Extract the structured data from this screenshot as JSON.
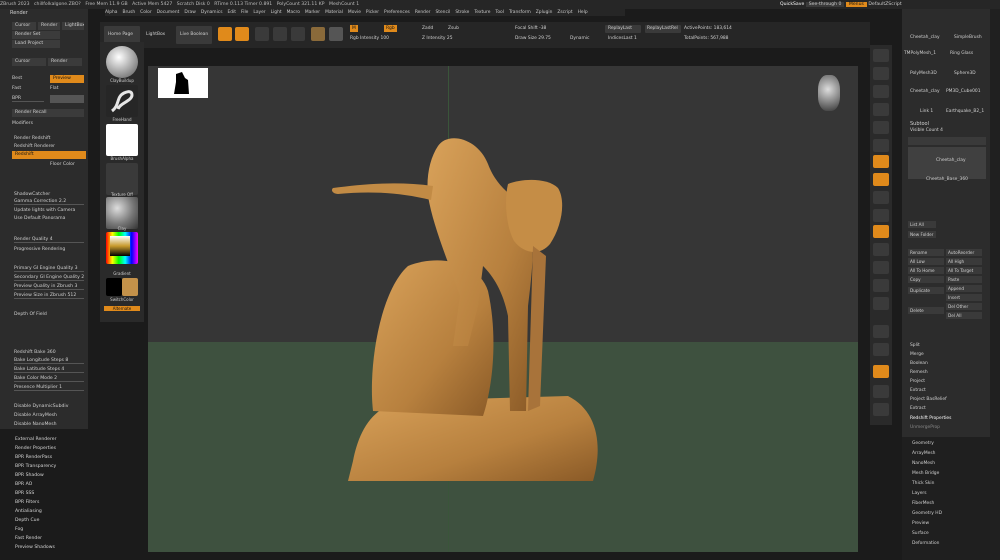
{
  "menubar": {
    "items": [
      "ZBrush 2023",
      "chillfolkalgone.ZBO?",
      "Free Mem 11.9 GB",
      "Active Mem 5427",
      "Scratch Disk 0",
      "RTime 0.113 Timer 0.891",
      "PolyCount 321.11 KP",
      "MeshCount 1"
    ],
    "menus": [
      "Alpha",
      "Brush",
      "Color",
      "Document",
      "Draw",
      "Dynamics",
      "Edit",
      "File",
      "Layer",
      "Light",
      "Macro",
      "Marker",
      "Material",
      "Movie",
      "Picker",
      "Preferences",
      "Render",
      "Stencil",
      "Stroke",
      "Texture",
      "Tool",
      "Transform",
      "Zplugin",
      "Zscript",
      "Help"
    ],
    "quicksave": "QuickSave",
    "seethrough": "See-through 0",
    "menus_btn": "Menus",
    "script": "DefaultZScript"
  },
  "left": {
    "title": "Render",
    "top_buttons": [
      "Cursor",
      "Render",
      "Best",
      "Preview",
      "Fast",
      "Flat"
    ],
    "lightbox": "LightBox",
    "render_set": "Render Set",
    "load_project": "Load Project",
    "bpr_btn": "BPR",
    "render_recall": "Render Recall",
    "modifiers": "Modifiers",
    "renderers": [
      "Render Redshift",
      "Redshift Renderer",
      "Redshift"
    ],
    "floor_color": "Floor Color",
    "shadowcatcher": "ShadowCatcher",
    "sliders": [
      {
        "label": "Gamma Correction 2.2",
        "v": 0.85
      },
      {
        "label": "Render Quality 4",
        "v": 0.35
      },
      {
        "label": "Primary GI Engine Quality 3",
        "v": 0.7
      },
      {
        "label": "Secondary GI Engine Quality 2",
        "v": 0.9
      },
      {
        "label": "Preview Quality in Zbrush 3",
        "v": 0.3
      },
      {
        "label": "Preview Size in Zbrush 512",
        "v": 0.55
      },
      {
        "label": "Bake Longitude Steps 8",
        "v": 0.3
      },
      {
        "label": "Bake Latitude Steps 4",
        "v": 0.3
      },
      {
        "label": "Bake Color Mode 2",
        "v": 0.4
      },
      {
        "label": "Presence Multiplier 1",
        "v": 0.2
      }
    ],
    "options": [
      "Update lights with Camera",
      "Use Default Panorama",
      "Progressive Rendering",
      "Depth Of Field",
      "Redshift Bake 360",
      "Disable DynamicSubdiv",
      "Disable ArrayMesh",
      "Disable NanoMesh"
    ],
    "bottom_list": [
      "External Renderer",
      "Render Properties",
      "BPR RenderPass",
      "BPR Transparency",
      "BPR Shadow",
      "BPR AO",
      "BPR SSS",
      "BPR Filters",
      "Antialiasing",
      "Depth Cue",
      "Fog",
      "Fast Render",
      "Preview Shadows"
    ]
  },
  "tools": {
    "labels": [
      "ClayBuildup",
      "FreeHand",
      "BrushAlpha",
      "Texture Off",
      "Clay",
      "Gradient",
      "SwitchColor",
      "Alternate"
    ]
  },
  "shelf": {
    "home": "Home Page",
    "lightbox": "LightBox",
    "live_boolean": "Live Boolean",
    "edit": "Edit",
    "draw": "Draw",
    "move": "Move",
    "scale": "Scale",
    "rotate": "Rotate",
    "m": "M",
    "rgb": "Rgb",
    "zadd": "Zadd",
    "zsub": "Zsub",
    "rgb_intensity": "Rgb Intensity 100",
    "z_intensity": "Z Intensity 25",
    "focal_shift": "Focal Shift -38",
    "draw_size": "Draw Size 29.75",
    "dynamic": "Dynamic",
    "replay_last": "ReplayLast",
    "replay_last_rel": "ReplayLastRel",
    "active_points": "ActivePoints: 183,614",
    "total_points": "TotalPoints: 567,988",
    "indices_last": "IndicesLast 1"
  },
  "right": {
    "top_tools": [
      "Cheetah_clay",
      "SimpleBrush",
      "TMPolyMesh_1",
      "Ring Glass",
      "PolyMesh3D",
      "Sphere3D",
      "Cheetah_clay",
      "PM3D_Cube001",
      "Link 1",
      "Earthquake_B2_1"
    ],
    "subtool": "Subtool",
    "visible_count": "Visible Count 4",
    "subtool_items": [
      "Cheetah_clay",
      "Cheetah_Base_360"
    ],
    "list_all": "List All",
    "new_folder": "New Folder",
    "buttons": [
      [
        "Rename",
        "AutoReorder"
      ],
      [
        "All Low",
        "All High"
      ],
      [
        "All To Home",
        "All To Target"
      ],
      [
        "Copy",
        "Paste"
      ],
      [
        "Duplicate",
        "Append"
      ],
      [
        "",
        "Insert"
      ],
      [
        "Delete",
        "Del Other"
      ],
      [
        "",
        "Del All"
      ]
    ],
    "section": [
      "Split",
      "Merge",
      "Boolean",
      "Remesh",
      "Project",
      "Extract",
      "Project BasRelief",
      "Extract"
    ],
    "redshift_props": "Redshift Properties",
    "unmerge": "UnmergeProp",
    "sections2": [
      "Geometry",
      "ArrayMesh",
      "NanoMesh",
      "Mesh Bridge",
      "Thick Skin",
      "Layers",
      "FiberMesh",
      "Geometry HD",
      "Preview",
      "Surface",
      "Deformation"
    ]
  }
}
